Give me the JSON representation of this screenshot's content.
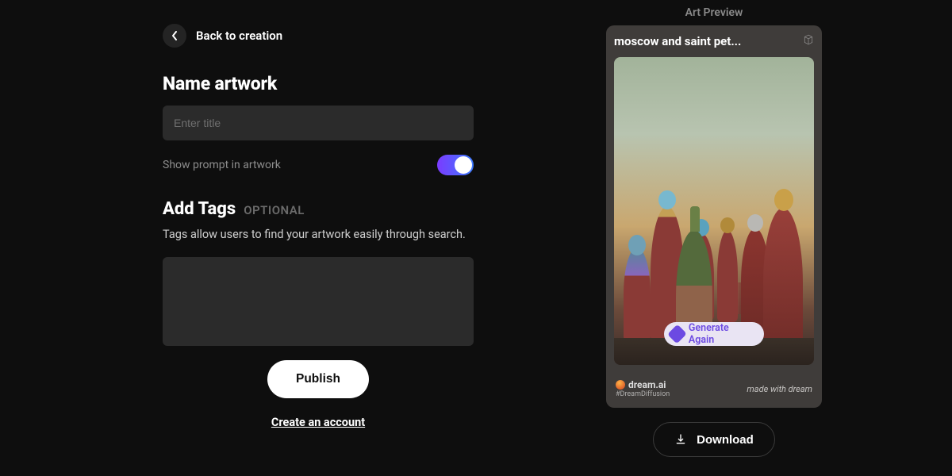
{
  "back": {
    "label": "Back to creation"
  },
  "nameSection": {
    "title": "Name artwork",
    "placeholder": "Enter title",
    "showPromptLabel": "Show prompt in artwork",
    "showPromptOn": true
  },
  "tagsSection": {
    "title": "Add Tags",
    "optional": "OPTIONAL",
    "description": "Tags allow users to find your artwork easily through search."
  },
  "actions": {
    "publish": "Publish",
    "createAccount": "Create an account",
    "download": "Download"
  },
  "preview": {
    "label": "Art Preview",
    "cardTitle": "moscow and saint pet...",
    "generateAgain": "Generate Again",
    "brand": "dream.ai",
    "brandSub": "#DreamDiffusion",
    "madeWith": "made with dream"
  }
}
